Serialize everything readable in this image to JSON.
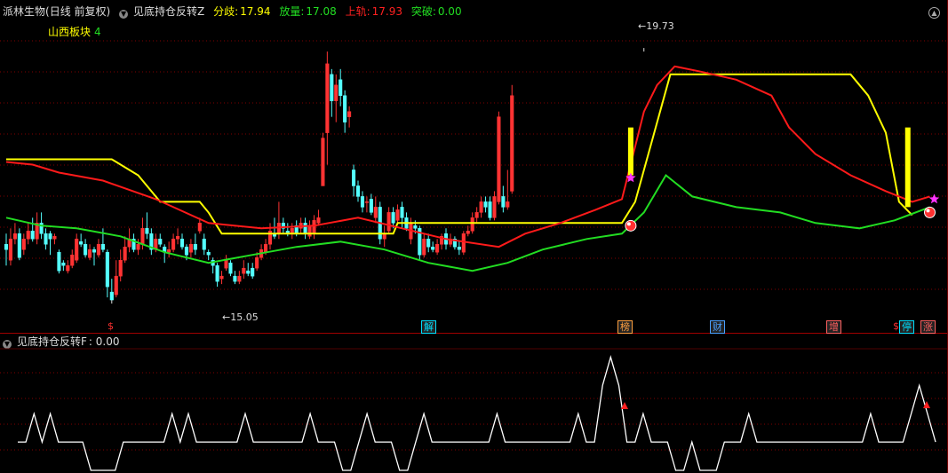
{
  "stock": {
    "name": "派林生物",
    "period": "日线 前复权"
  },
  "main_indicator": {
    "name": "见底持仓反转Z",
    "fenqi_label": "分歧:",
    "fenqi_value": "17.94",
    "fangliang_label": "放量:",
    "fangliang_value": "17.08",
    "shanggui_label": "上轨:",
    "shanggui_value": "17.93",
    "tupo_label": "突破:",
    "tupo_value": "0.00"
  },
  "sector": {
    "label": "山西板块",
    "count": "4"
  },
  "price_marks": {
    "high": "19.73",
    "low": "15.05"
  },
  "event_tags": [
    {
      "text": "$",
      "color": "#ff3030"
    },
    {
      "text": "解",
      "color": "#00e0ff"
    },
    {
      "text": "榜",
      "color": "#ffa040"
    },
    {
      "text": "财",
      "color": "#4aa0ff"
    },
    {
      "text": "增",
      "color": "#ff6060"
    },
    {
      "text": "$",
      "color": "#ff3030"
    },
    {
      "text": "停",
      "color": "#00e0ff"
    },
    {
      "text": "涨",
      "color": "#ff6060"
    }
  ],
  "sub_indicator": {
    "name": "见底持仓反转F",
    "value_text": ": 0.00"
  },
  "colors": {
    "up": "#ff3333",
    "down": "#54ffff",
    "yellow": "#ffff00",
    "red_line": "#ff1a1a",
    "green_line": "#22dd22",
    "grid": "#800000"
  },
  "chart_data": {
    "type": "candlestick",
    "price_ylim": [
      14.6,
      20.4
    ],
    "candles": [
      [
        16.1,
        16.0,
        16.3,
        15.7
      ],
      [
        15.8,
        16.2,
        16.4,
        15.7
      ],
      [
        16.2,
        16.3,
        16.5,
        16.1
      ],
      [
        16.3,
        15.85,
        16.4,
        15.8
      ],
      [
        16.0,
        16.2,
        16.3,
        15.9
      ],
      [
        16.2,
        16.35,
        16.5,
        16.1
      ],
      [
        16.35,
        16.2,
        16.6,
        16.15
      ],
      [
        16.2,
        16.5,
        16.7,
        16.1
      ],
      [
        16.5,
        16.3,
        16.7,
        16.2
      ],
      [
        16.3,
        16.1,
        16.4,
        16.0
      ],
      [
        16.3,
        16.2,
        16.35,
        15.9
      ],
      [
        16.2,
        16.25,
        16.3,
        16.1
      ],
      [
        15.95,
        15.6,
        16.0,
        15.55
      ],
      [
        15.75,
        15.7,
        15.8,
        15.6
      ],
      [
        15.6,
        15.7,
        15.8,
        15.55
      ],
      [
        15.7,
        15.9,
        16.0,
        15.65
      ],
      [
        15.8,
        16.2,
        16.3,
        15.75
      ],
      [
        16.15,
        16.1,
        16.3,
        16.05
      ],
      [
        16.1,
        15.9,
        16.2,
        15.85
      ],
      [
        15.85,
        16.0,
        16.1,
        15.8
      ],
      [
        16.0,
        15.95,
        16.05,
        15.7
      ],
      [
        15.9,
        16.1,
        16.2,
        15.85
      ],
      [
        16.1,
        16.0,
        16.4,
        15.95
      ],
      [
        15.95,
        15.3,
        16.0,
        15.1
      ],
      [
        15.2,
        15.05,
        15.45,
        15.05
      ],
      [
        15.15,
        15.5,
        15.8,
        15.1
      ],
      [
        15.5,
        15.8,
        16.0,
        15.4
      ],
      [
        15.8,
        16.05,
        16.25,
        15.75
      ],
      [
        16.05,
        16.2,
        16.4,
        15.95
      ],
      [
        16.2,
        16.0,
        16.3,
        15.95
      ],
      [
        16.0,
        16.1,
        16.2,
        15.9
      ],
      [
        16.1,
        16.4,
        16.6,
        16.0
      ],
      [
        16.4,
        16.3,
        16.7,
        16.2
      ],
      [
        16.3,
        16.0,
        16.4,
        15.9
      ],
      [
        16.0,
        16.2,
        16.3,
        15.95
      ],
      [
        16.2,
        16.1,
        16.3,
        16.05
      ],
      [
        16.05,
        15.95,
        16.1,
        15.75
      ],
      [
        15.95,
        16.0,
        16.15,
        15.85
      ],
      [
        16.0,
        16.2,
        16.3,
        15.95
      ],
      [
        16.2,
        16.25,
        16.4,
        16.1
      ],
      [
        16.2,
        16.05,
        16.3,
        16.0
      ],
      [
        16.05,
        15.9,
        16.1,
        15.8
      ],
      [
        15.95,
        16.1,
        16.2,
        15.85
      ],
      [
        16.1,
        16.0,
        16.3,
        15.9
      ],
      [
        16.35,
        16.5,
        16.6,
        16.3
      ],
      [
        16.2,
        16.0,
        16.3,
        15.9
      ],
      [
        15.95,
        15.9,
        16.0,
        15.8
      ],
      [
        15.8,
        15.7,
        15.85,
        15.55
      ],
      [
        15.7,
        15.4,
        15.75,
        15.3
      ],
      [
        15.45,
        15.5,
        15.6,
        15.35
      ],
      [
        15.65,
        15.8,
        15.9,
        15.6
      ],
      [
        15.75,
        15.55,
        15.8,
        15.5
      ],
      [
        15.5,
        15.4,
        15.6,
        15.35
      ],
      [
        15.4,
        15.5,
        15.6,
        15.35
      ],
      [
        15.55,
        15.65,
        15.8,
        15.45
      ],
      [
        15.6,
        15.55,
        15.75,
        15.5
      ],
      [
        15.65,
        15.5,
        15.75,
        15.45
      ],
      [
        15.65,
        15.85,
        15.95,
        15.6
      ],
      [
        15.85,
        16.0,
        16.1,
        15.8
      ],
      [
        15.95,
        16.1,
        16.2,
        15.9
      ],
      [
        16.1,
        16.35,
        16.5,
        16.0
      ],
      [
        16.3,
        16.25,
        16.6,
        16.2
      ],
      [
        16.3,
        16.5,
        16.9,
        16.2
      ],
      [
        16.5,
        16.4,
        16.6,
        16.3
      ],
      [
        16.35,
        16.3,
        16.5,
        16.25
      ],
      [
        16.3,
        16.4,
        16.5,
        16.2
      ],
      [
        16.45,
        16.3,
        16.55,
        16.25
      ],
      [
        16.4,
        16.5,
        16.6,
        16.3
      ],
      [
        16.5,
        16.3,
        16.6,
        16.2
      ],
      [
        16.25,
        16.45,
        16.55,
        16.2
      ],
      [
        16.3,
        16.55,
        16.65,
        16.2
      ],
      [
        16.5,
        16.6,
        16.75,
        16.45
      ],
      [
        17.2,
        18.1,
        18.2,
        17.2
      ],
      [
        18.2,
        19.5,
        19.73,
        17.6
      ],
      [
        19.3,
        18.8,
        19.4,
        18.5
      ],
      [
        18.8,
        19.1,
        19.3,
        18.4
      ],
      [
        19.2,
        18.9,
        19.4,
        18.7
      ],
      [
        18.9,
        18.4,
        19.0,
        18.2
      ],
      [
        18.5,
        18.6,
        18.7,
        18.3
      ],
      [
        17.5,
        17.2,
        17.6,
        17.0
      ],
      [
        17.2,
        17.0,
        17.3,
        16.9
      ],
      [
        17.0,
        16.8,
        17.1,
        16.7
      ],
      [
        16.9,
        16.9,
        17.0,
        16.7
      ],
      [
        16.95,
        16.7,
        17.05,
        16.65
      ],
      [
        16.6,
        16.8,
        17.0,
        16.5
      ],
      [
        16.8,
        16.2,
        16.9,
        16.1
      ],
      [
        16.2,
        16.3,
        16.45,
        16.05
      ],
      [
        16.35,
        16.7,
        16.8,
        16.3
      ],
      [
        16.7,
        16.5,
        16.8,
        16.4
      ],
      [
        16.55,
        16.75,
        16.85,
        16.5
      ],
      [
        16.8,
        16.6,
        16.9,
        16.4
      ],
      [
        16.6,
        16.4,
        16.7,
        16.35
      ],
      [
        16.2,
        16.5,
        16.6,
        16.1
      ],
      [
        16.45,
        16.4,
        16.55,
        16.3
      ],
      [
        16.4,
        15.9,
        16.45,
        15.8
      ],
      [
        15.9,
        16.2,
        16.3,
        15.85
      ],
      [
        16.2,
        16.05,
        16.3,
        15.95
      ],
      [
        16.05,
        16.0,
        16.15,
        15.95
      ],
      [
        15.95,
        16.1,
        16.2,
        15.9
      ],
      [
        16.1,
        16.25,
        16.3,
        16.0
      ],
      [
        16.3,
        16.1,
        16.4,
        16.0
      ],
      [
        16.1,
        16.2,
        16.3,
        16.05
      ],
      [
        16.2,
        16.05,
        16.25,
        16.0
      ],
      [
        16.05,
        16.0,
        16.15,
        15.9
      ],
      [
        15.95,
        16.3,
        16.35,
        15.9
      ],
      [
        16.3,
        16.35,
        16.45,
        16.25
      ],
      [
        16.35,
        16.6,
        16.7,
        16.3
      ],
      [
        16.6,
        16.7,
        16.8,
        16.5
      ],
      [
        16.7,
        16.9,
        17.0,
        16.6
      ],
      [
        16.9,
        16.8,
        17.0,
        16.7
      ],
      [
        16.9,
        16.6,
        17.0,
        16.55
      ],
      [
        16.6,
        17.0,
        17.1,
        16.55
      ],
      [
        16.9,
        18.5,
        18.6,
        16.85
      ],
      [
        17.0,
        16.8,
        17.2,
        16.7
      ],
      [
        16.8,
        16.9,
        17.5,
        16.75
      ],
      [
        17.1,
        18.9,
        19.1,
        17.05
      ]
    ],
    "yellow_line": [
      [
        0,
        17.7
      ],
      [
        24,
        17.7
      ],
      [
        30,
        17.4
      ],
      [
        35,
        16.9
      ],
      [
        44,
        16.9
      ],
      [
        46,
        16.7
      ],
      [
        49,
        16.3
      ],
      [
        88,
        16.3
      ],
      [
        89,
        16.5
      ],
      [
        140,
        16.5
      ],
      [
        143,
        16.9
      ],
      [
        151,
        19.3
      ],
      [
        192,
        19.3
      ],
      [
        196,
        18.9
      ],
      [
        200,
        18.2
      ],
      [
        203,
        16.9
      ],
      [
        206,
        16.65
      ]
    ],
    "red_line": [
      [
        0,
        17.65
      ],
      [
        6,
        17.6
      ],
      [
        12,
        17.45
      ],
      [
        22,
        17.3
      ],
      [
        34,
        16.95
      ],
      [
        46,
        16.5
      ],
      [
        58,
        16.4
      ],
      [
        70,
        16.45
      ],
      [
        80,
        16.6
      ],
      [
        90,
        16.4
      ],
      [
        100,
        16.2
      ],
      [
        112,
        16.05
      ],
      [
        118,
        16.3
      ],
      [
        126,
        16.5
      ],
      [
        134,
        16.75
      ],
      [
        140,
        16.95
      ],
      [
        145,
        18.6
      ],
      [
        148,
        19.1
      ],
      [
        152,
        19.45
      ],
      [
        158,
        19.35
      ],
      [
        166,
        19.2
      ],
      [
        174,
        18.9
      ],
      [
        178,
        18.3
      ],
      [
        184,
        17.8
      ],
      [
        192,
        17.4
      ],
      [
        200,
        17.1
      ],
      [
        206,
        16.9
      ],
      [
        210,
        17.0
      ]
    ],
    "green_line": [
      [
        0,
        16.6
      ],
      [
        8,
        16.45
      ],
      [
        16,
        16.4
      ],
      [
        26,
        16.25
      ],
      [
        36,
        15.95
      ],
      [
        46,
        15.75
      ],
      [
        56,
        15.9
      ],
      [
        66,
        16.05
      ],
      [
        76,
        16.15
      ],
      [
        86,
        16.0
      ],
      [
        96,
        15.75
      ],
      [
        106,
        15.6
      ],
      [
        114,
        15.75
      ],
      [
        122,
        16.0
      ],
      [
        132,
        16.2
      ],
      [
        140,
        16.3
      ],
      [
        145,
        16.7
      ],
      [
        150,
        17.4
      ],
      [
        156,
        17.0
      ],
      [
        166,
        16.8
      ],
      [
        176,
        16.7
      ],
      [
        184,
        16.5
      ],
      [
        194,
        16.4
      ],
      [
        202,
        16.55
      ],
      [
        210,
        16.8
      ]
    ],
    "sub_values": [
      1,
      1,
      2,
      1,
      2,
      1,
      1,
      1,
      1,
      0,
      0,
      0,
      0,
      1,
      1,
      1,
      1,
      1,
      1,
      2,
      1,
      2,
      1,
      1,
      1,
      1,
      1,
      1,
      2,
      1,
      1,
      1,
      1,
      1,
      1,
      1,
      2,
      1,
      1,
      1,
      0,
      0,
      1,
      2,
      1,
      1,
      1,
      0,
      0,
      1,
      2,
      1,
      1,
      1,
      1,
      1,
      1,
      1,
      1,
      2,
      1,
      1,
      1,
      1,
      1,
      1,
      1,
      1,
      1,
      2,
      1,
      1,
      3,
      4,
      3,
      1,
      1,
      2,
      1,
      1,
      1,
      0,
      0,
      1,
      0,
      0,
      0,
      1,
      1,
      1,
      2,
      1,
      1,
      1,
      1,
      1,
      1,
      1,
      1,
      1,
      1,
      1,
      1,
      1,
      1,
      2,
      1,
      1,
      1,
      1,
      2,
      3,
      2,
      1
    ],
    "sub_ylim": [
      0,
      4.2
    ]
  }
}
